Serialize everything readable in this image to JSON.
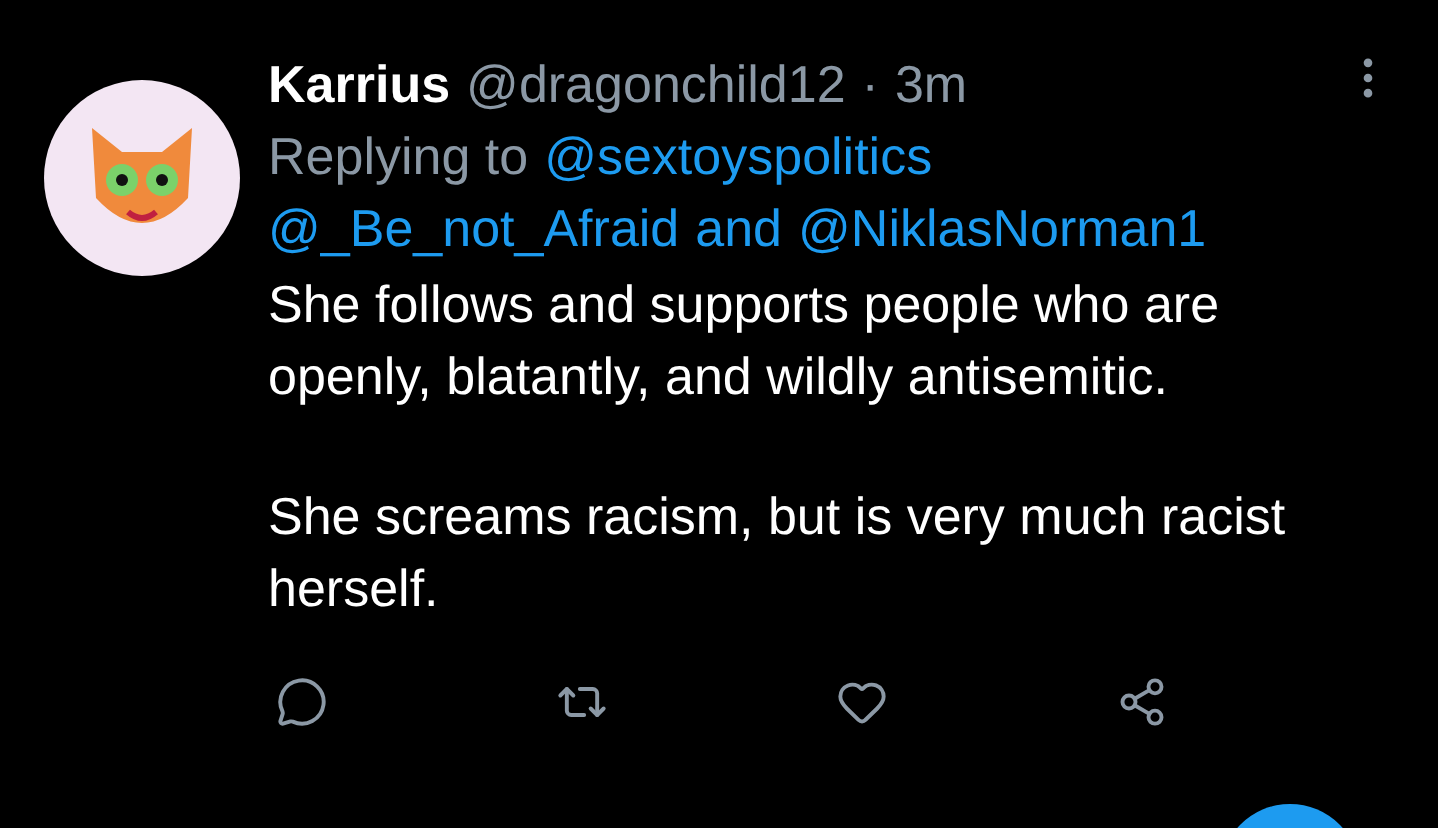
{
  "tweet": {
    "author": {
      "name": "Karrius",
      "handle": "@dragonchild12",
      "separator": "·",
      "time": "3m"
    },
    "replying_to": {
      "prefix": "Replying to",
      "mentions": [
        "@sextoyspolitics",
        "@_Be_not_Afraid",
        "@NiklasNorman1"
      ],
      "conjunction": "and"
    },
    "paragraphs": [
      "She follows and supports people who are openly, blatantly, and wildly antisemitic.",
      "She screams racism, but is very much racist herself."
    ]
  }
}
